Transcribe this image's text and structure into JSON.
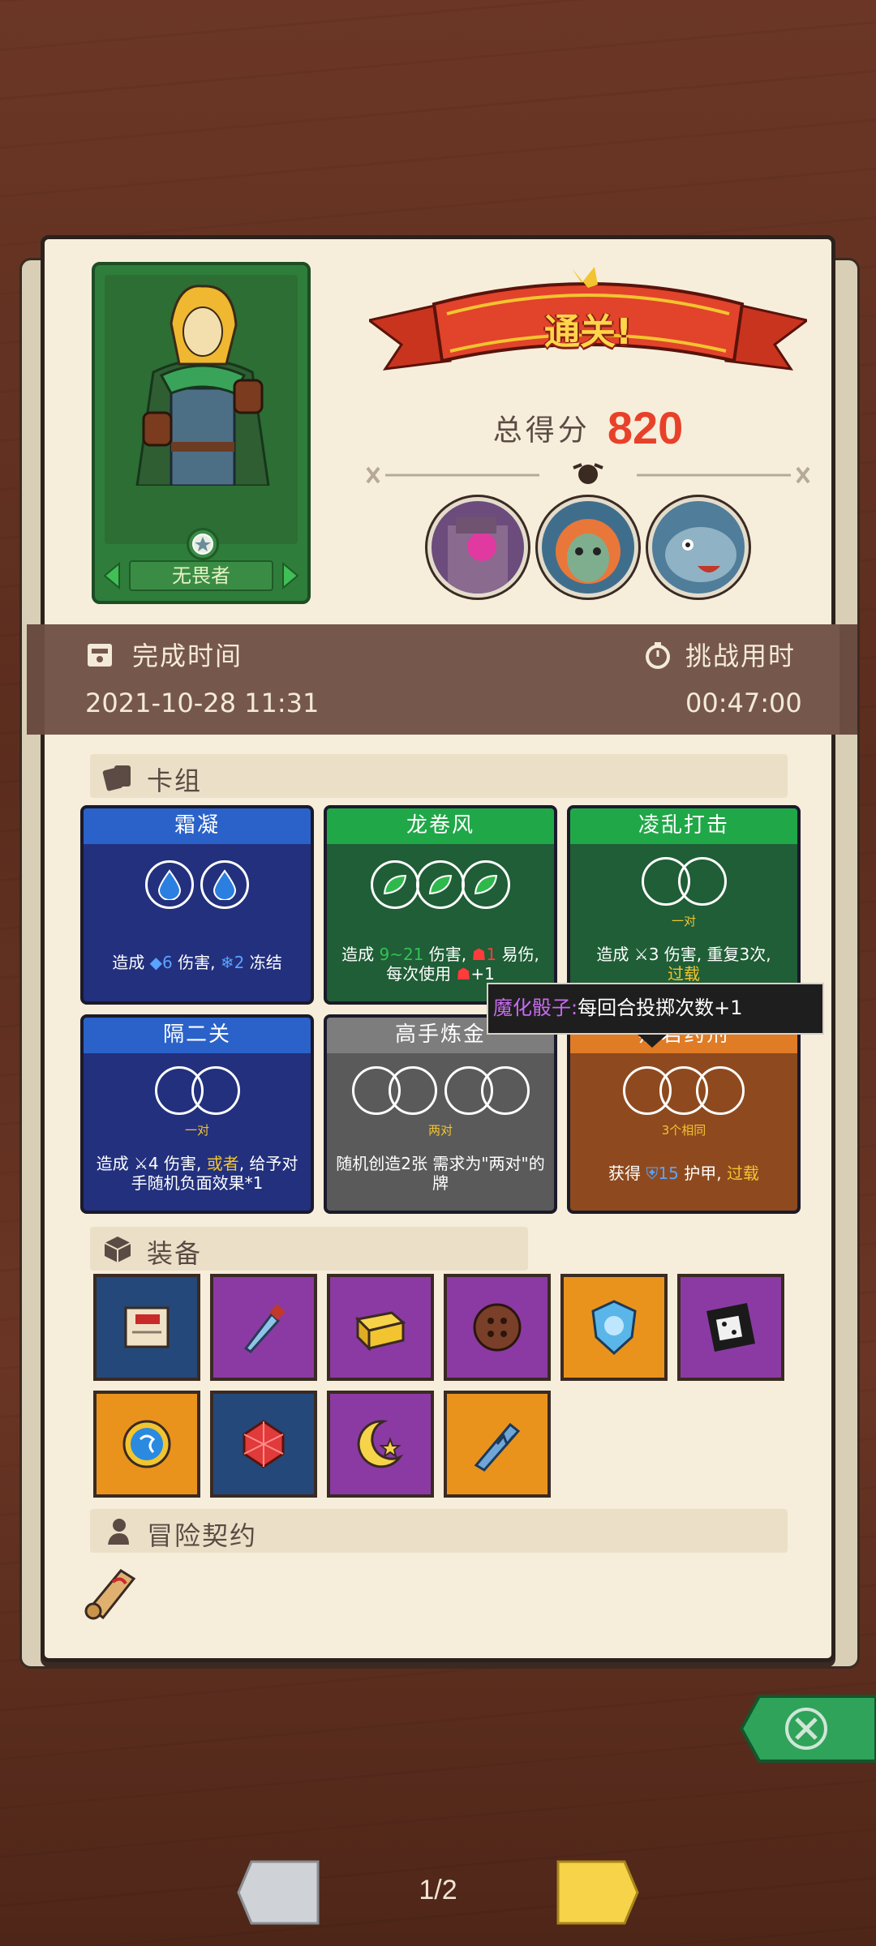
{
  "hero": {
    "name": "无畏者"
  },
  "result": {
    "banner": "通关!",
    "score_label": "总得分",
    "score_value": "820"
  },
  "bosses": [
    {
      "name": "boss-1"
    },
    {
      "name": "boss-2"
    },
    {
      "name": "boss-3"
    }
  ],
  "time": {
    "finish_label": "完成时间",
    "finish_value": "2021-10-28 11:31",
    "challenge_label": "挑战用时",
    "challenge_value": "00:47:00"
  },
  "sections": {
    "deck": "卡组",
    "equipment": "装备",
    "contract": "冒险契约"
  },
  "cards": [
    {
      "title": "霜凝",
      "req": "",
      "desc_a": "造成 ",
      "desc_b": "6",
      "desc_c": " 伤害, ",
      "desc_d": "2",
      "desc_e": " 冻结"
    },
    {
      "title": "龙卷风",
      "req": "",
      "desc_a": "造成 ",
      "desc_b": "9~21",
      "desc_c": " 伤害, ",
      "desc_d": "1",
      "desc_e": " 易伤, 每次使用 ",
      "desc_f": "+1"
    },
    {
      "title": "凌乱打击",
      "req": "一对",
      "desc_a": "造成 ",
      "desc_b": "3",
      "desc_c": " 伤害, 重复3次,",
      "desc_d": "过载"
    },
    {
      "title": "隔二关",
      "req": "一对",
      "desc_a": "造成 ",
      "desc_b": "4",
      "desc_c": " 伤害, ",
      "desc_d": "或者",
      "desc_e": ", 给予对手随机负面效果*1"
    },
    {
      "title": "高手炼金",
      "req": "两对",
      "desc_a": "随机创造2张 需求为\"两对\"的牌"
    },
    {
      "title": "黑岩药剂",
      "req": "3个相同",
      "desc_a": "获得 ",
      "desc_b": "15",
      "desc_c": " 护甲, ",
      "desc_d": "过载"
    }
  ],
  "equipment_items": [
    {
      "icon": "scroll-icon",
      "bg": "#24487a"
    },
    {
      "icon": "ice-dagger-icon",
      "bg": "#8b3aa4"
    },
    {
      "icon": "gold-box-icon",
      "bg": "#8b3aa4"
    },
    {
      "icon": "wooden-button-icon",
      "bg": "#8b3aa4"
    },
    {
      "icon": "ice-shield-icon",
      "bg": "#e9931d"
    },
    {
      "icon": "cursed-dice-icon",
      "bg": "#8b3aa4"
    },
    {
      "icon": "blue-orb-icon",
      "bg": "#e9931d"
    },
    {
      "icon": "ruby-icon",
      "bg": "#24487a"
    },
    {
      "icon": "moon-star-icon",
      "bg": "#8b3aa4"
    },
    {
      "icon": "broken-blade-icon",
      "bg": "#e9931d"
    }
  ],
  "tooltip": {
    "name": "魔化骰子:",
    "text": "每回合投掷次数+1"
  },
  "pager": {
    "label": "1/2"
  }
}
